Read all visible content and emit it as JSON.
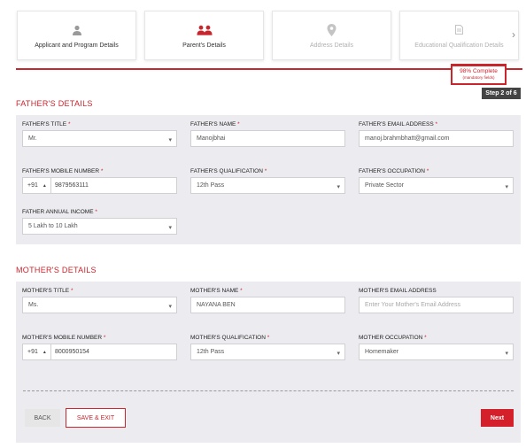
{
  "steps": [
    {
      "label": "Applicant and Program Details",
      "icon": "person-icon",
      "state": "done"
    },
    {
      "label": "Parent's Details",
      "icon": "parents-icon",
      "state": "active"
    },
    {
      "label": "Address Details",
      "icon": "location-pin-icon",
      "state": "upcoming"
    },
    {
      "label": "Educational Qualification Details",
      "icon": "document-icon",
      "state": "upcoming"
    }
  ],
  "progress": {
    "complete_text": "98% Complete",
    "note": "(mandatory fields)",
    "percent": 98,
    "step_badge": "Step 2 of 6"
  },
  "colors": {
    "accent": "#c9252c",
    "panel": "#ececf0",
    "badge": "#444444"
  },
  "father": {
    "section_title": "FATHER'S DETAILS",
    "title": {
      "label": "FATHER'S TITLE",
      "value": "Mr."
    },
    "name": {
      "label": "FATHER'S NAME",
      "value": "Manojbhai"
    },
    "email": {
      "label": "FATHER'S EMAIL ADDRESS",
      "value": "manoj.brahmbhatt@gmail.com"
    },
    "mobile": {
      "label": "FATHER'S MOBILE NUMBER",
      "code": "+91",
      "value": "9879563111"
    },
    "qualification": {
      "label": "FATHER'S QUALIFICATION",
      "value": "12th Pass"
    },
    "occupation": {
      "label": "FATHER'S OCCUPATION",
      "value": "Private Sector"
    },
    "income": {
      "label": "FATHER ANNUAL INCOME",
      "value": "5 Lakh to 10 Lakh"
    }
  },
  "mother": {
    "section_title": "MOTHER'S DETAILS",
    "title": {
      "label": "MOTHER'S TITLE",
      "value": "Ms."
    },
    "name": {
      "label": "MOTHER'S NAME",
      "value": "NAYANA BEN"
    },
    "email": {
      "label": "MOTHER'S EMAIL ADDRESS",
      "placeholder": "Enter Your Mother's Email Address"
    },
    "mobile": {
      "label": "MOTHER'S MOBILE NUMBER",
      "code": "+91",
      "value": "8000950154"
    },
    "qualification": {
      "label": "MOTHER'S QUALIFICATION",
      "value": "12th Pass"
    },
    "occupation": {
      "label": "MOTHER OCCUPATION",
      "value": "Homemaker"
    }
  },
  "buttons": {
    "back": "BACK",
    "save_exit": "SAVE & EXIT",
    "next": "Next"
  }
}
